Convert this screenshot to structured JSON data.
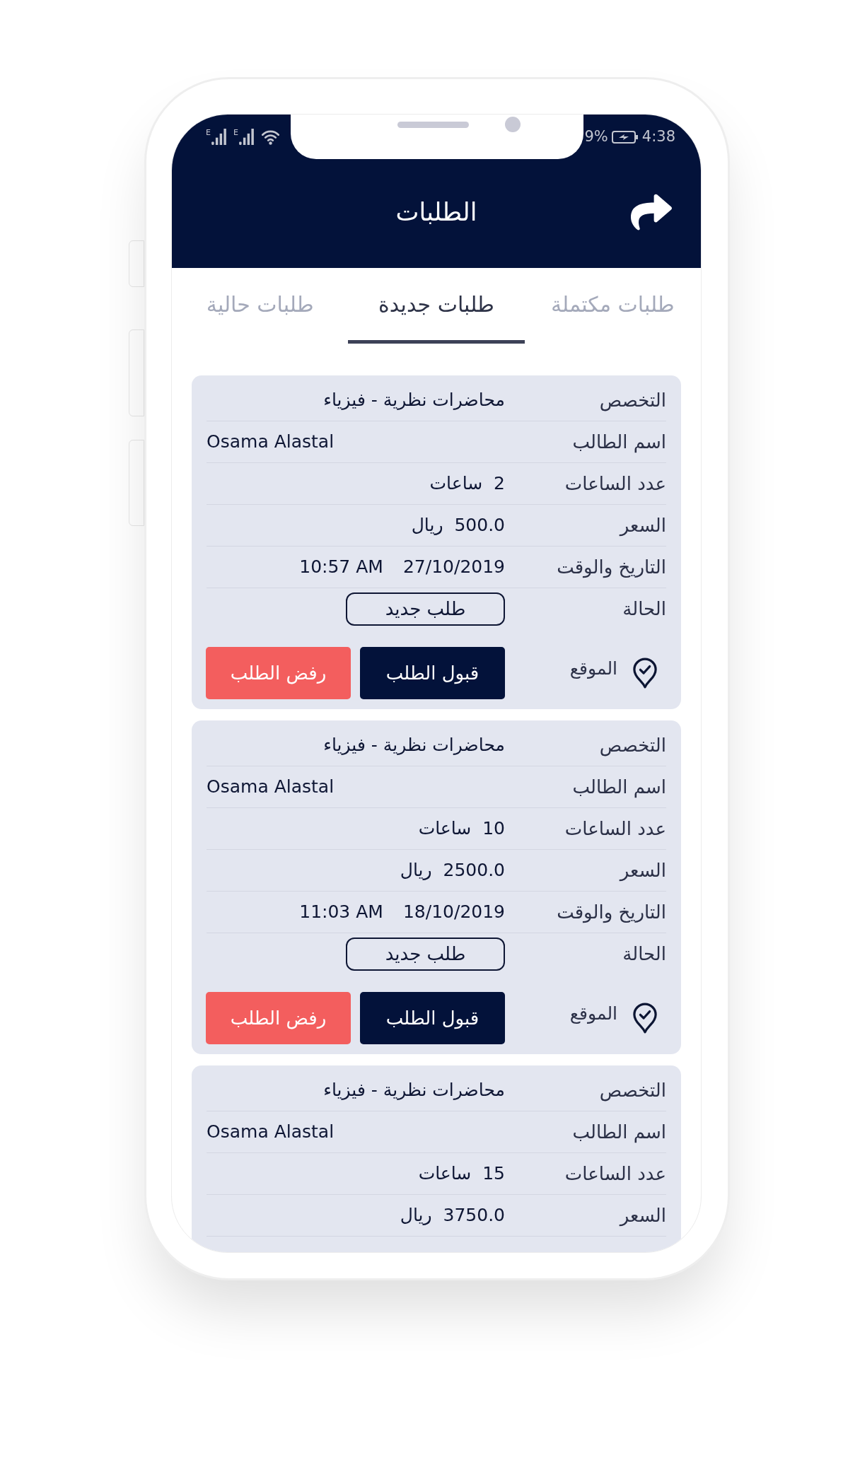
{
  "status_bar": {
    "time": "4:38",
    "battery": "9%",
    "signals": [
      {
        "network": "E"
      },
      {
        "network": "E"
      }
    ]
  },
  "header": {
    "title": "الطلبات"
  },
  "tabs": [
    {
      "label": "طلبات مكتملة",
      "selected": false
    },
    {
      "label": "طلبات جديدة",
      "selected": true
    },
    {
      "label": "طلبات حالية",
      "selected": false
    }
  ],
  "orders": [
    {
      "rows": [
        {
          "kind": "text",
          "label": "التخصص",
          "value": "محاضرات نظرية - فيزياء"
        },
        {
          "kind": "text",
          "label": "اسم الطالب",
          "value": "Osama Alastal"
        },
        {
          "kind": "text",
          "label": "عدد الساعات",
          "value": "2  ساعات"
        },
        {
          "kind": "text",
          "label": "السعر",
          "value": "500.0  ريال"
        },
        {
          "kind": "datetime",
          "label": "التاريخ والوقت",
          "date": "27/10/2019",
          "time": "10:57 AM"
        },
        {
          "kind": "status",
          "label": "الحالة",
          "value": "طلب جديد"
        }
      ],
      "actions": {
        "location": "الموقع",
        "accept": "قبول الطلب",
        "reject": "رفض الطلب"
      }
    },
    {
      "rows": [
        {
          "kind": "text",
          "label": "التخصص",
          "value": "محاضرات نظرية - فيزياء"
        },
        {
          "kind": "text",
          "label": "اسم الطالب",
          "value": "Osama Alastal"
        },
        {
          "kind": "text",
          "label": "عدد الساعات",
          "value": "10  ساعات"
        },
        {
          "kind": "text",
          "label": "السعر",
          "value": "2500.0  ريال"
        },
        {
          "kind": "datetime",
          "label": "التاريخ والوقت",
          "date": "18/10/2019",
          "time": "11:03 AM"
        },
        {
          "kind": "status",
          "label": "الحالة",
          "value": "طلب جديد"
        }
      ],
      "actions": {
        "location": "الموقع",
        "accept": "قبول الطلب",
        "reject": "رفض الطلب"
      }
    },
    {
      "rows": [
        {
          "kind": "text",
          "label": "التخصص",
          "value": "محاضرات نظرية - فيزياء"
        },
        {
          "kind": "text",
          "label": "اسم الطالب",
          "value": "Osama Alastal"
        },
        {
          "kind": "text",
          "label": "عدد الساعات",
          "value": "15  ساعات"
        },
        {
          "kind": "text",
          "label": "السعر",
          "value": "3750.0  ريال"
        }
      ]
    }
  ]
}
